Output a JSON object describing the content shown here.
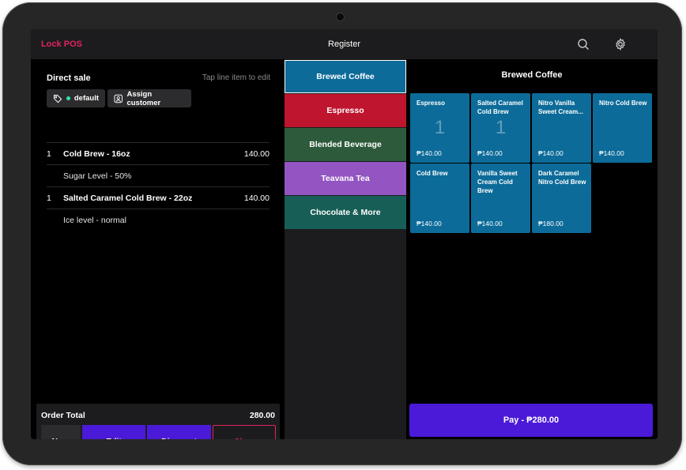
{
  "colors": {
    "brand": "#e0245e",
    "accent": "#4b1ad8",
    "tile": "#0c6b99",
    "cat_brewed": "#0c6b99",
    "cat_espresso": "#c0152e",
    "cat_blended": "#2c5a3a",
    "cat_teavana": "#9255c2",
    "cat_chocolate": "#175e56"
  },
  "topbar": {
    "brand": "Lock POS",
    "title": "Register",
    "icons": [
      "search-icon",
      "gear-icon"
    ]
  },
  "order": {
    "title": "Direct sale",
    "hint": "Tap line item to edit",
    "price_list_chip": "default",
    "assign_customer": "Assign customer",
    "lines": [
      {
        "qty": "1",
        "name": "Cold Brew - 16oz",
        "price": "140.00",
        "modifier": "Sugar Level - 50%"
      },
      {
        "qty": "1",
        "name": "Salted Caramel  Cold Brew - 22oz",
        "price": "140.00",
        "modifier": "Ice level - normal"
      }
    ],
    "total_label": "Order Total",
    "total_value": "280.00",
    "buttons": {
      "num": "Num",
      "edit": "Edit",
      "discount": "Discount",
      "clear": "Clear"
    }
  },
  "categories": [
    {
      "label": "Brewed Coffee",
      "selected": true
    },
    {
      "label": "Espresso",
      "selected": false
    },
    {
      "label": "Blended Beverage",
      "selected": false
    },
    {
      "label": "Teavana Tea",
      "selected": false
    },
    {
      "label": "Chocolate & More",
      "selected": false
    }
  ],
  "products": {
    "title": "Brewed Coffee",
    "items": [
      {
        "name": "Espresso",
        "price": "₱140.00",
        "qty": "1"
      },
      {
        "name": "Salted Caramel Cold Brew",
        "price": "₱140.00",
        "qty": "1"
      },
      {
        "name": "Nitro Vanilla Sweet Cream...",
        "price": "₱140.00",
        "qty": ""
      },
      {
        "name": "Nitro Cold Brew",
        "price": "₱140.00",
        "qty": ""
      },
      {
        "name": "Cold Brew",
        "price": "₱140.00",
        "qty": ""
      },
      {
        "name": "Vanilla Sweet Cream Cold Brew",
        "price": "₱140.00",
        "qty": ""
      },
      {
        "name": "Dark Caramel Nitro Cold Brew",
        "price": "₱180.00",
        "qty": ""
      }
    ],
    "pay_label": "Pay - ₱280.00"
  }
}
